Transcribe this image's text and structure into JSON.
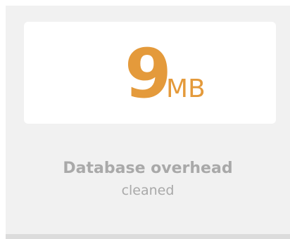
{
  "stat": {
    "value": "9",
    "unit": "MB",
    "accent_color": "#e49a3b"
  },
  "caption": {
    "title": "Database overhead",
    "subtitle": "cleaned",
    "text_color": "#a9a9a9"
  }
}
